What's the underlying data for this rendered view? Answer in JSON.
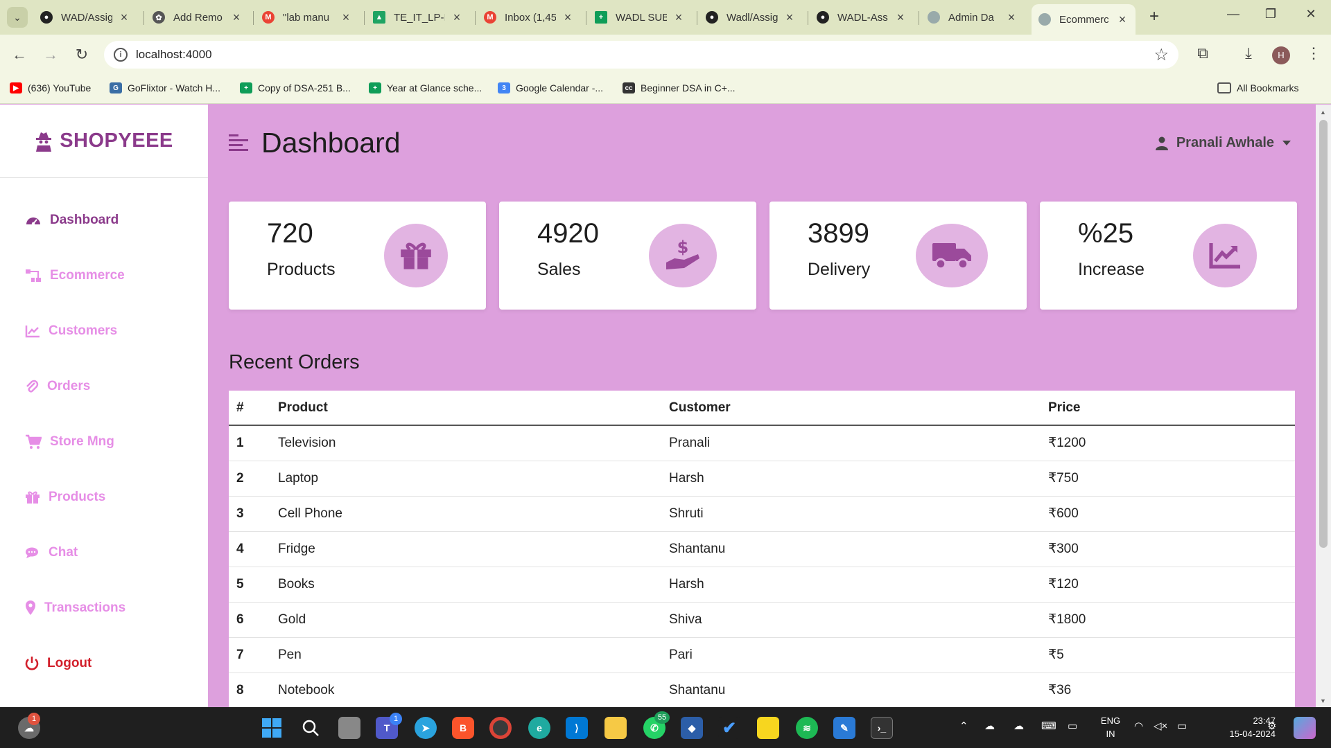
{
  "browser": {
    "tabs": [
      {
        "label": "WAD/Assig",
        "icon": "github-icon"
      },
      {
        "label": "Add Remo",
        "icon": "chatgpt-icon"
      },
      {
        "label": "\"lab manu",
        "icon": "gmail-icon"
      },
      {
        "label": "TE_IT_LP-II",
        "icon": "drive-icon"
      },
      {
        "label": "Inbox (1,45",
        "icon": "gmail-icon"
      },
      {
        "label": "WADL SUB",
        "icon": "sheets-icon"
      },
      {
        "label": "Wadl/Assig",
        "icon": "github-icon"
      },
      {
        "label": "WADL-Ass",
        "icon": "github-icon"
      },
      {
        "label": "Admin Da",
        "icon": "globe-icon"
      },
      {
        "label": "Ecommerc",
        "icon": "globe-icon",
        "active": true
      }
    ],
    "url": "localhost:4000",
    "profile_initial": "H",
    "bookmarks": [
      {
        "label": "(636) YouTube"
      },
      {
        "label": "GoFlixtor - Watch H..."
      },
      {
        "label": "Copy of DSA-251 B..."
      },
      {
        "label": "Year at Glance sche..."
      },
      {
        "label": "Google Calendar -..."
      },
      {
        "label": "Beginner DSA in C+..."
      }
    ],
    "all_bookmarks": "All Bookmarks"
  },
  "sidebar": {
    "brand": "SHOPYEEE",
    "items": [
      {
        "label": "Dashboard",
        "icon": "gauge-icon"
      },
      {
        "label": "Ecommerce",
        "icon": "sitemap-icon"
      },
      {
        "label": "Customers",
        "icon": "chart-line-icon"
      },
      {
        "label": "Orders",
        "icon": "paperclip-icon"
      },
      {
        "label": "Store Mng",
        "icon": "cart-icon"
      },
      {
        "label": "Products",
        "icon": "gift-icon"
      },
      {
        "label": "Chat",
        "icon": "comments-icon"
      },
      {
        "label": "Transactions",
        "icon": "map-pin-icon"
      },
      {
        "label": "Logout",
        "icon": "power-icon"
      }
    ]
  },
  "header": {
    "title": "Dashboard",
    "user": "Pranali Awhale"
  },
  "cards": [
    {
      "value": "720",
      "label": "Products",
      "icon": "gift-icon"
    },
    {
      "value": "4920",
      "label": "Sales",
      "icon": "hand-dollar-icon"
    },
    {
      "value": "3899",
      "label": "Delivery",
      "icon": "truck-icon"
    },
    {
      "value": "%25",
      "label": "Increase",
      "icon": "chart-line-icon"
    }
  ],
  "orders": {
    "title": "Recent Orders",
    "columns": [
      "#",
      "Product",
      "Customer",
      "Price"
    ],
    "rows": [
      [
        "1",
        "Television",
        "Pranali",
        "₹1200"
      ],
      [
        "2",
        "Laptop",
        "Harsh",
        "₹750"
      ],
      [
        "3",
        "Cell Phone",
        "Shruti",
        "₹600"
      ],
      [
        "4",
        "Fridge",
        "Shantanu",
        "₹300"
      ],
      [
        "5",
        "Books",
        "Harsh",
        "₹120"
      ],
      [
        "6",
        "Gold",
        "Shiva",
        "₹1800"
      ],
      [
        "7",
        "Pen",
        "Pari",
        "₹5"
      ],
      [
        "8",
        "Notebook",
        "Shantanu",
        "₹36"
      ]
    ]
  },
  "taskbar": {
    "notification_badge": "1",
    "teams_badge": "1",
    "whatsapp_badge": "55",
    "lang_line1": "ENG",
    "lang_line2": "IN",
    "time": "23:47",
    "date": "15-04-2024"
  }
}
